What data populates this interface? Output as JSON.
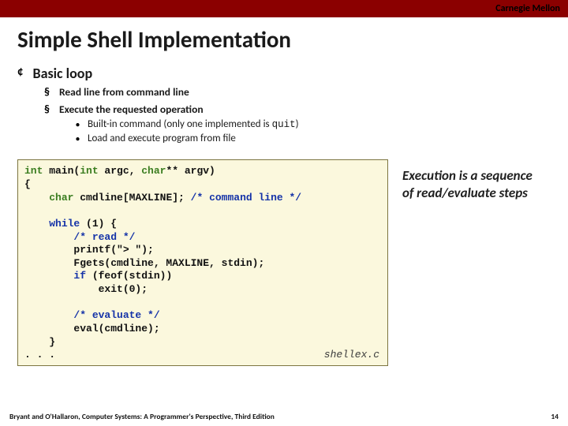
{
  "header": {
    "org": "Carnegie Mellon"
  },
  "title": "Simple Shell Implementation",
  "bullets": {
    "l1": "Basic loop",
    "l2a": "Read line from command line",
    "l2b": "Execute the requested operation",
    "l3a_pre": "Built-in command (only one implemented is ",
    "l3a_code": "quit",
    "l3a_post": ")",
    "l3b": "Load and execute program from file"
  },
  "code": {
    "l01a": "int",
    "l01b": " main(",
    "l01c": "int",
    "l01d": " argc, ",
    "l01e": "char",
    "l01f": "** argv)",
    "l02": "{",
    "l03a": "    ",
    "l03b": "char",
    "l03c": " cmdline[MAXLINE]; ",
    "l03d": "/* command line */",
    "l05a": "    ",
    "l05b": "while",
    "l05c": " (1) {",
    "l06": "        /* read */",
    "l07": "        printf(\"> \");",
    "l08": "        Fgets(cmdline, MAXLINE, stdin);",
    "l09a": "        ",
    "l09b": "if",
    "l09c": " (feof(stdin))",
    "l10": "            exit(0);",
    "l12": "        /* evaluate */",
    "l13": "        eval(cmdline);",
    "l14": "    }",
    "l15": ". . .",
    "filename": "shellex.c"
  },
  "sidenote": "Execution is a sequence of read/evaluate steps",
  "footer": {
    "credit": "Bryant and O'Hallaron, Computer Systems: A Programmer's Perspective, Third Edition",
    "page": "14"
  },
  "chart_data": null
}
